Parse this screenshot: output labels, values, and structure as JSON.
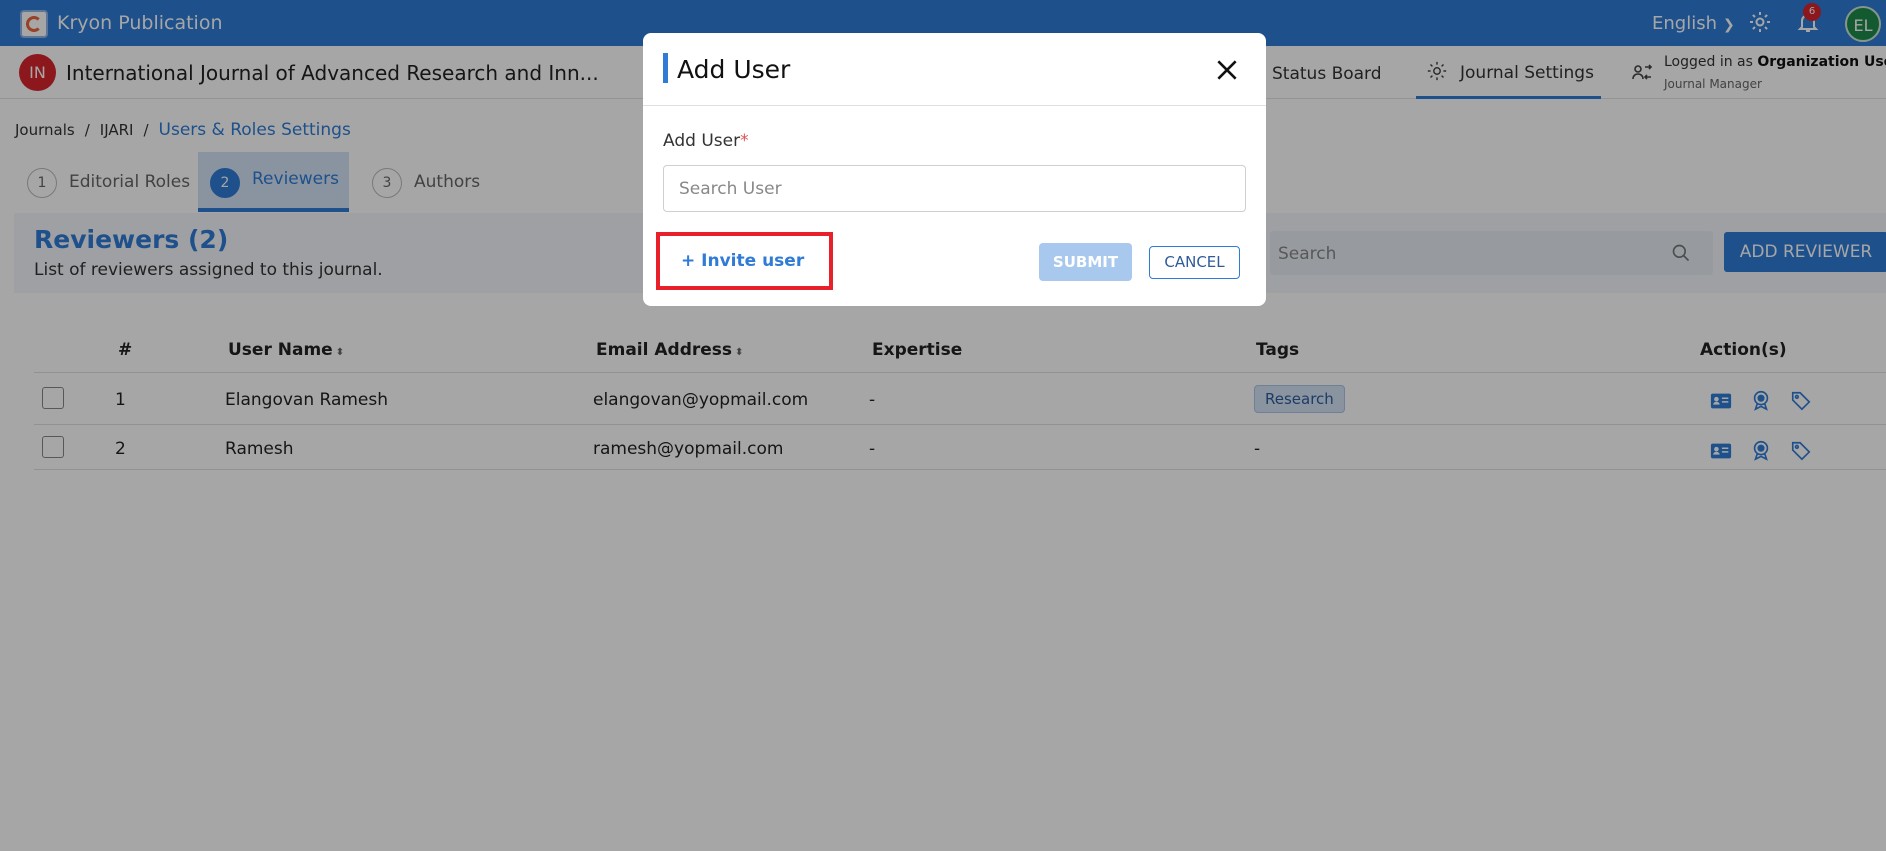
{
  "app": {
    "title": "Kryon Publication",
    "language": "English",
    "notification_count": "6",
    "user_initials": "EL"
  },
  "journal": {
    "badge": "IN",
    "title": "International Journal of Advanced Research and Inn..."
  },
  "nav": {
    "status_board": "Status Board",
    "journal_settings": "Journal Settings"
  },
  "logged_in": {
    "prefix": "Logged in as ",
    "org": "Organization User",
    "role": "Journal Manager"
  },
  "breadcrumb": {
    "item1": "Journals",
    "item2": "IJARI",
    "current": "Users & Roles Settings",
    "separator": "/"
  },
  "tabs": [
    {
      "num": "1",
      "label": "Editorial Roles"
    },
    {
      "num": "2",
      "label": "Reviewers"
    },
    {
      "num": "3",
      "label": "Authors"
    }
  ],
  "section": {
    "title": "Reviewers (2)",
    "subtitle": "List of reviewers assigned to this journal.",
    "search_placeholder": "Search",
    "add_button": "ADD REVIEWER"
  },
  "table": {
    "headers": {
      "num": "#",
      "user_name": "User Name",
      "email": "Email Address",
      "expertise": "Expertise",
      "tags": "Tags",
      "actions": "Action(s)"
    },
    "sort_glyph": "⬍",
    "rows": [
      {
        "num": "1",
        "name": "Elangovan Ramesh",
        "email": "elangovan@yopmail.com",
        "expertise": "-",
        "tag": "Research"
      },
      {
        "num": "2",
        "name": "Ramesh",
        "email": "ramesh@yopmail.com",
        "expertise": "-",
        "tag": "-"
      }
    ]
  },
  "modal": {
    "title": "Add User",
    "field_label": "Add User",
    "required_mark": "*",
    "search_placeholder": "Search User",
    "invite_label": "+ Invite user",
    "submit_label": "SUBMIT",
    "cancel_label": "CANCEL"
  }
}
